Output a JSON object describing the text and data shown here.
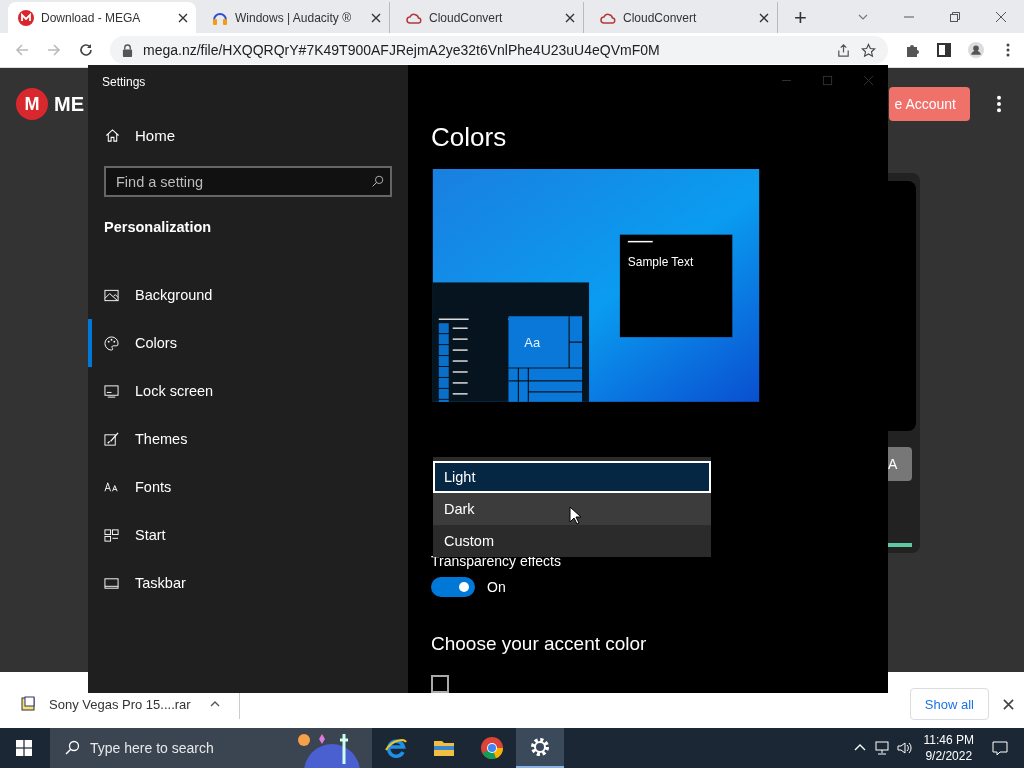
{
  "browser": {
    "tabs": [
      {
        "title": "Download - MEGA",
        "selected": true
      },
      {
        "title": "Windows | Audacity ®",
        "selected": false
      },
      {
        "title": "CloudConvert",
        "selected": false
      },
      {
        "title": "CloudConvert",
        "selected": false
      }
    ],
    "new_tab": "+",
    "url": "mega.nz/file/HXQQRQrY#7K49T900AFJRejmA2ye32t6VnlPhe4U23uU4eQVmF0M"
  },
  "page": {
    "logo_letter": "M",
    "logo_text": "ME",
    "account_button": "e Account",
    "card_button": "A"
  },
  "settings": {
    "title": "Settings",
    "home": "Home",
    "search": {
      "placeholder": "Find a setting"
    },
    "section": "Personalization",
    "nav": [
      {
        "label": "Background",
        "selected": false
      },
      {
        "label": "Colors",
        "selected": true
      },
      {
        "label": "Lock screen",
        "selected": false
      },
      {
        "label": "Themes",
        "selected": false
      },
      {
        "label": "Fonts",
        "selected": false
      },
      {
        "label": "Start",
        "selected": false
      },
      {
        "label": "Taskbar",
        "selected": false
      }
    ],
    "heading": "Colors",
    "preview": {
      "sample_text": "Sample Text",
      "tile_text": "Aa"
    },
    "dropdown": [
      {
        "label": "Light",
        "selected": true,
        "hovered": false
      },
      {
        "label": "Dark",
        "selected": false,
        "hovered": true
      },
      {
        "label": "Custom",
        "selected": false,
        "hovered": false
      }
    ],
    "transparency": {
      "label": "Transparency effects",
      "on": true,
      "state_text": "On"
    },
    "accent_heading": "Choose your accent color",
    "auto_accent": {
      "checked": false
    }
  },
  "downloads": {
    "file": "Sony Vegas Pro 15....rar",
    "show_all": "Show all"
  },
  "taskbar": {
    "search": {
      "placeholder": "Type here to search"
    },
    "apps": [
      {
        "kind": "ie",
        "active": false
      },
      {
        "kind": "explorer",
        "active": false
      },
      {
        "kind": "chrome",
        "active": false
      },
      {
        "kind": "settings",
        "active": true
      }
    ],
    "time": "11:46 PM",
    "date": "9/2/2022"
  }
}
